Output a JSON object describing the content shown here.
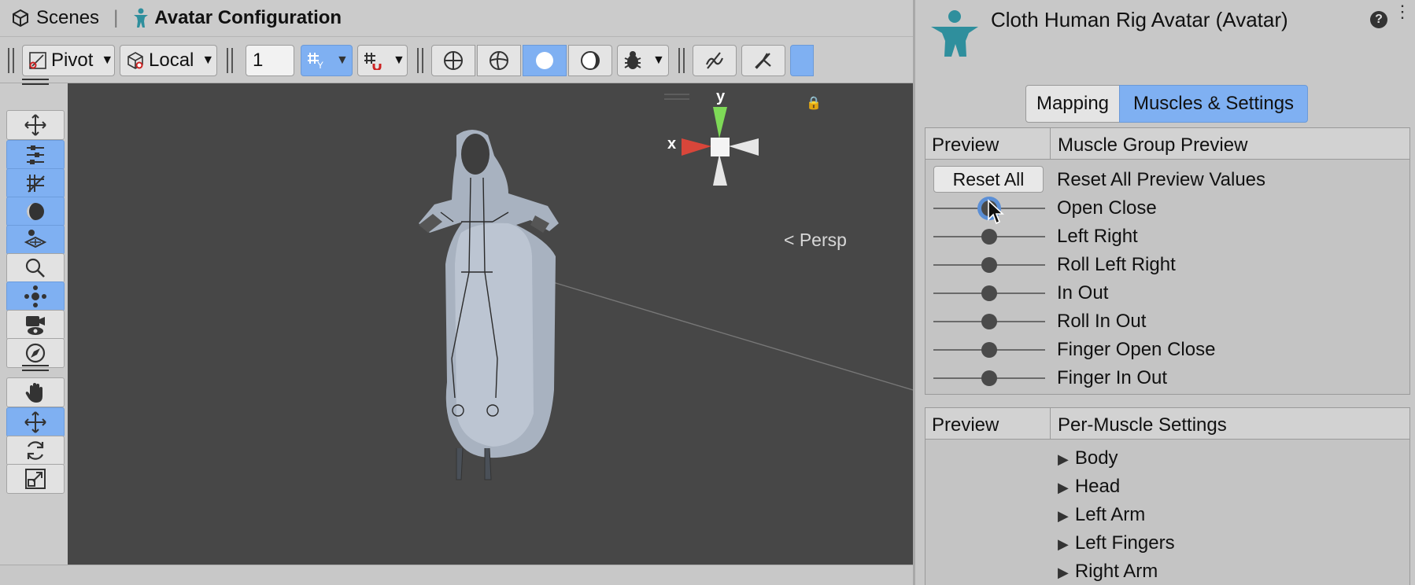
{
  "breadcrumb": {
    "scenes_label": "Scenes",
    "current_label": "Avatar Configuration"
  },
  "toolbar": {
    "pivot_label": "Pivot",
    "space_label": "Local",
    "grid_snap_value": "1"
  },
  "viewport": {
    "axis_x": "x",
    "axis_y": "y",
    "projection_label": "Persp"
  },
  "inspector": {
    "title": "Cloth Human Rig Avatar (Avatar)",
    "tabs": [
      {
        "label": "Mapping",
        "active": false
      },
      {
        "label": "Muscles & Settings",
        "active": true
      }
    ],
    "muscle_group_preview": {
      "col1": "Preview",
      "col2": "Muscle Group Preview",
      "reset_button": "Reset All",
      "reset_label": "Reset All Preview Values",
      "sliders": [
        {
          "label": "Open Close",
          "value": 0.5
        },
        {
          "label": "Left Right",
          "value": 0.5
        },
        {
          "label": "Roll Left Right",
          "value": 0.5
        },
        {
          "label": "In Out",
          "value": 0.5
        },
        {
          "label": "Roll In Out",
          "value": 0.5
        },
        {
          "label": "Finger Open Close",
          "value": 0.5
        },
        {
          "label": "Finger In Out",
          "value": 0.5
        }
      ]
    },
    "per_muscle_settings": {
      "col1": "Preview",
      "col2": "Per-Muscle Settings",
      "groups": [
        "Body",
        "Head",
        "Left Arm",
        "Left Fingers",
        "Right Arm"
      ]
    }
  },
  "colors": {
    "accent": "#7fb0f2",
    "viewport_bg": "#474747",
    "axis_x": "#d9463a",
    "axis_y": "#7ed957",
    "avatar_icon": "#2f8f9d"
  },
  "icons": [
    "unity-logo-icon",
    "avatar-icon",
    "pivot-icon",
    "local-icon",
    "grid-snap-icon",
    "snap-increment-icon",
    "shading-wireframe-icon",
    "shading-shaded-wireframe-icon",
    "shading-solid-icon",
    "shading-lit-icon",
    "gizmos-icon",
    "audio-mute-icon",
    "effects-icon",
    "move-icon",
    "rect-icon",
    "grid-icon",
    "sphere-icon",
    "pivot-tool-icon",
    "search-icon",
    "transform-icon",
    "camera-icon",
    "compass-icon",
    "hand-icon",
    "rotate-icon",
    "scale-icon",
    "help-icon",
    "more-icon",
    "lock-icon",
    "cursor-icon"
  ]
}
